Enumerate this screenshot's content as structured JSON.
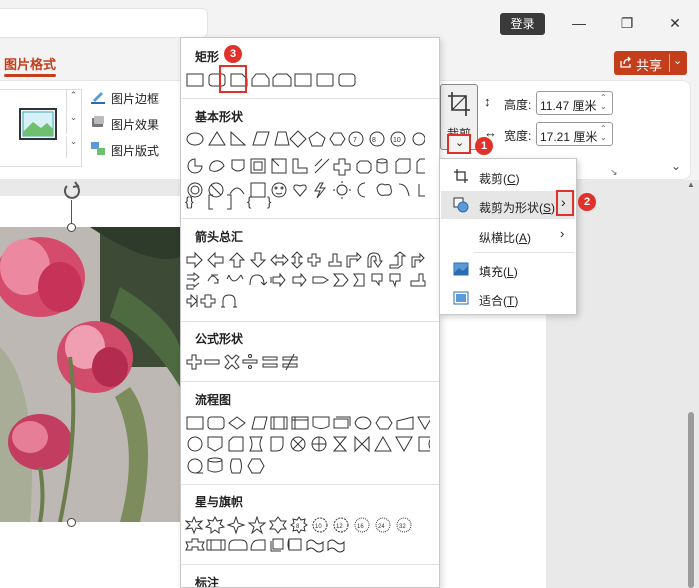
{
  "titlebar": {
    "login_label": "登录"
  },
  "ribbon": {
    "active_tab": "图片格式",
    "share_label": "共享",
    "picture_border": "图片边框",
    "picture_effects": "图片效果",
    "picture_layout": "图片版式",
    "crop_label": "裁剪",
    "height_label": "高度:",
    "height_value": "11.47 厘米",
    "width_label": "宽度:",
    "width_value": "17.21 厘米"
  },
  "shapes_panel": {
    "categories": [
      {
        "title": "矩形"
      },
      {
        "title": "基本形状"
      },
      {
        "title": "箭头总汇"
      },
      {
        "title": "公式形状"
      },
      {
        "title": "流程图"
      },
      {
        "title": "星与旗帜"
      },
      {
        "title": "标注"
      }
    ]
  },
  "crop_menu": {
    "items": [
      {
        "label": "裁剪(",
        "key": "C",
        "tail": ")",
        "icon": "crop-icon"
      },
      {
        "label": "裁剪为形状(",
        "key": "S",
        "tail": ")",
        "icon": "crop-to-shape-icon"
      },
      {
        "label": "纵横比(",
        "key": "A",
        "tail": ")",
        "icon": ""
      },
      {
        "label": "填充(",
        "key": "L",
        "tail": ")",
        "icon": "fill-icon"
      },
      {
        "label": "适合(",
        "key": "T",
        "tail": ")",
        "icon": "fit-icon"
      }
    ]
  },
  "badges": {
    "one": "1",
    "two": "2",
    "three": "3"
  },
  "colors": {
    "accent": "#c43e1c",
    "annotation_red": "#e0312b"
  }
}
